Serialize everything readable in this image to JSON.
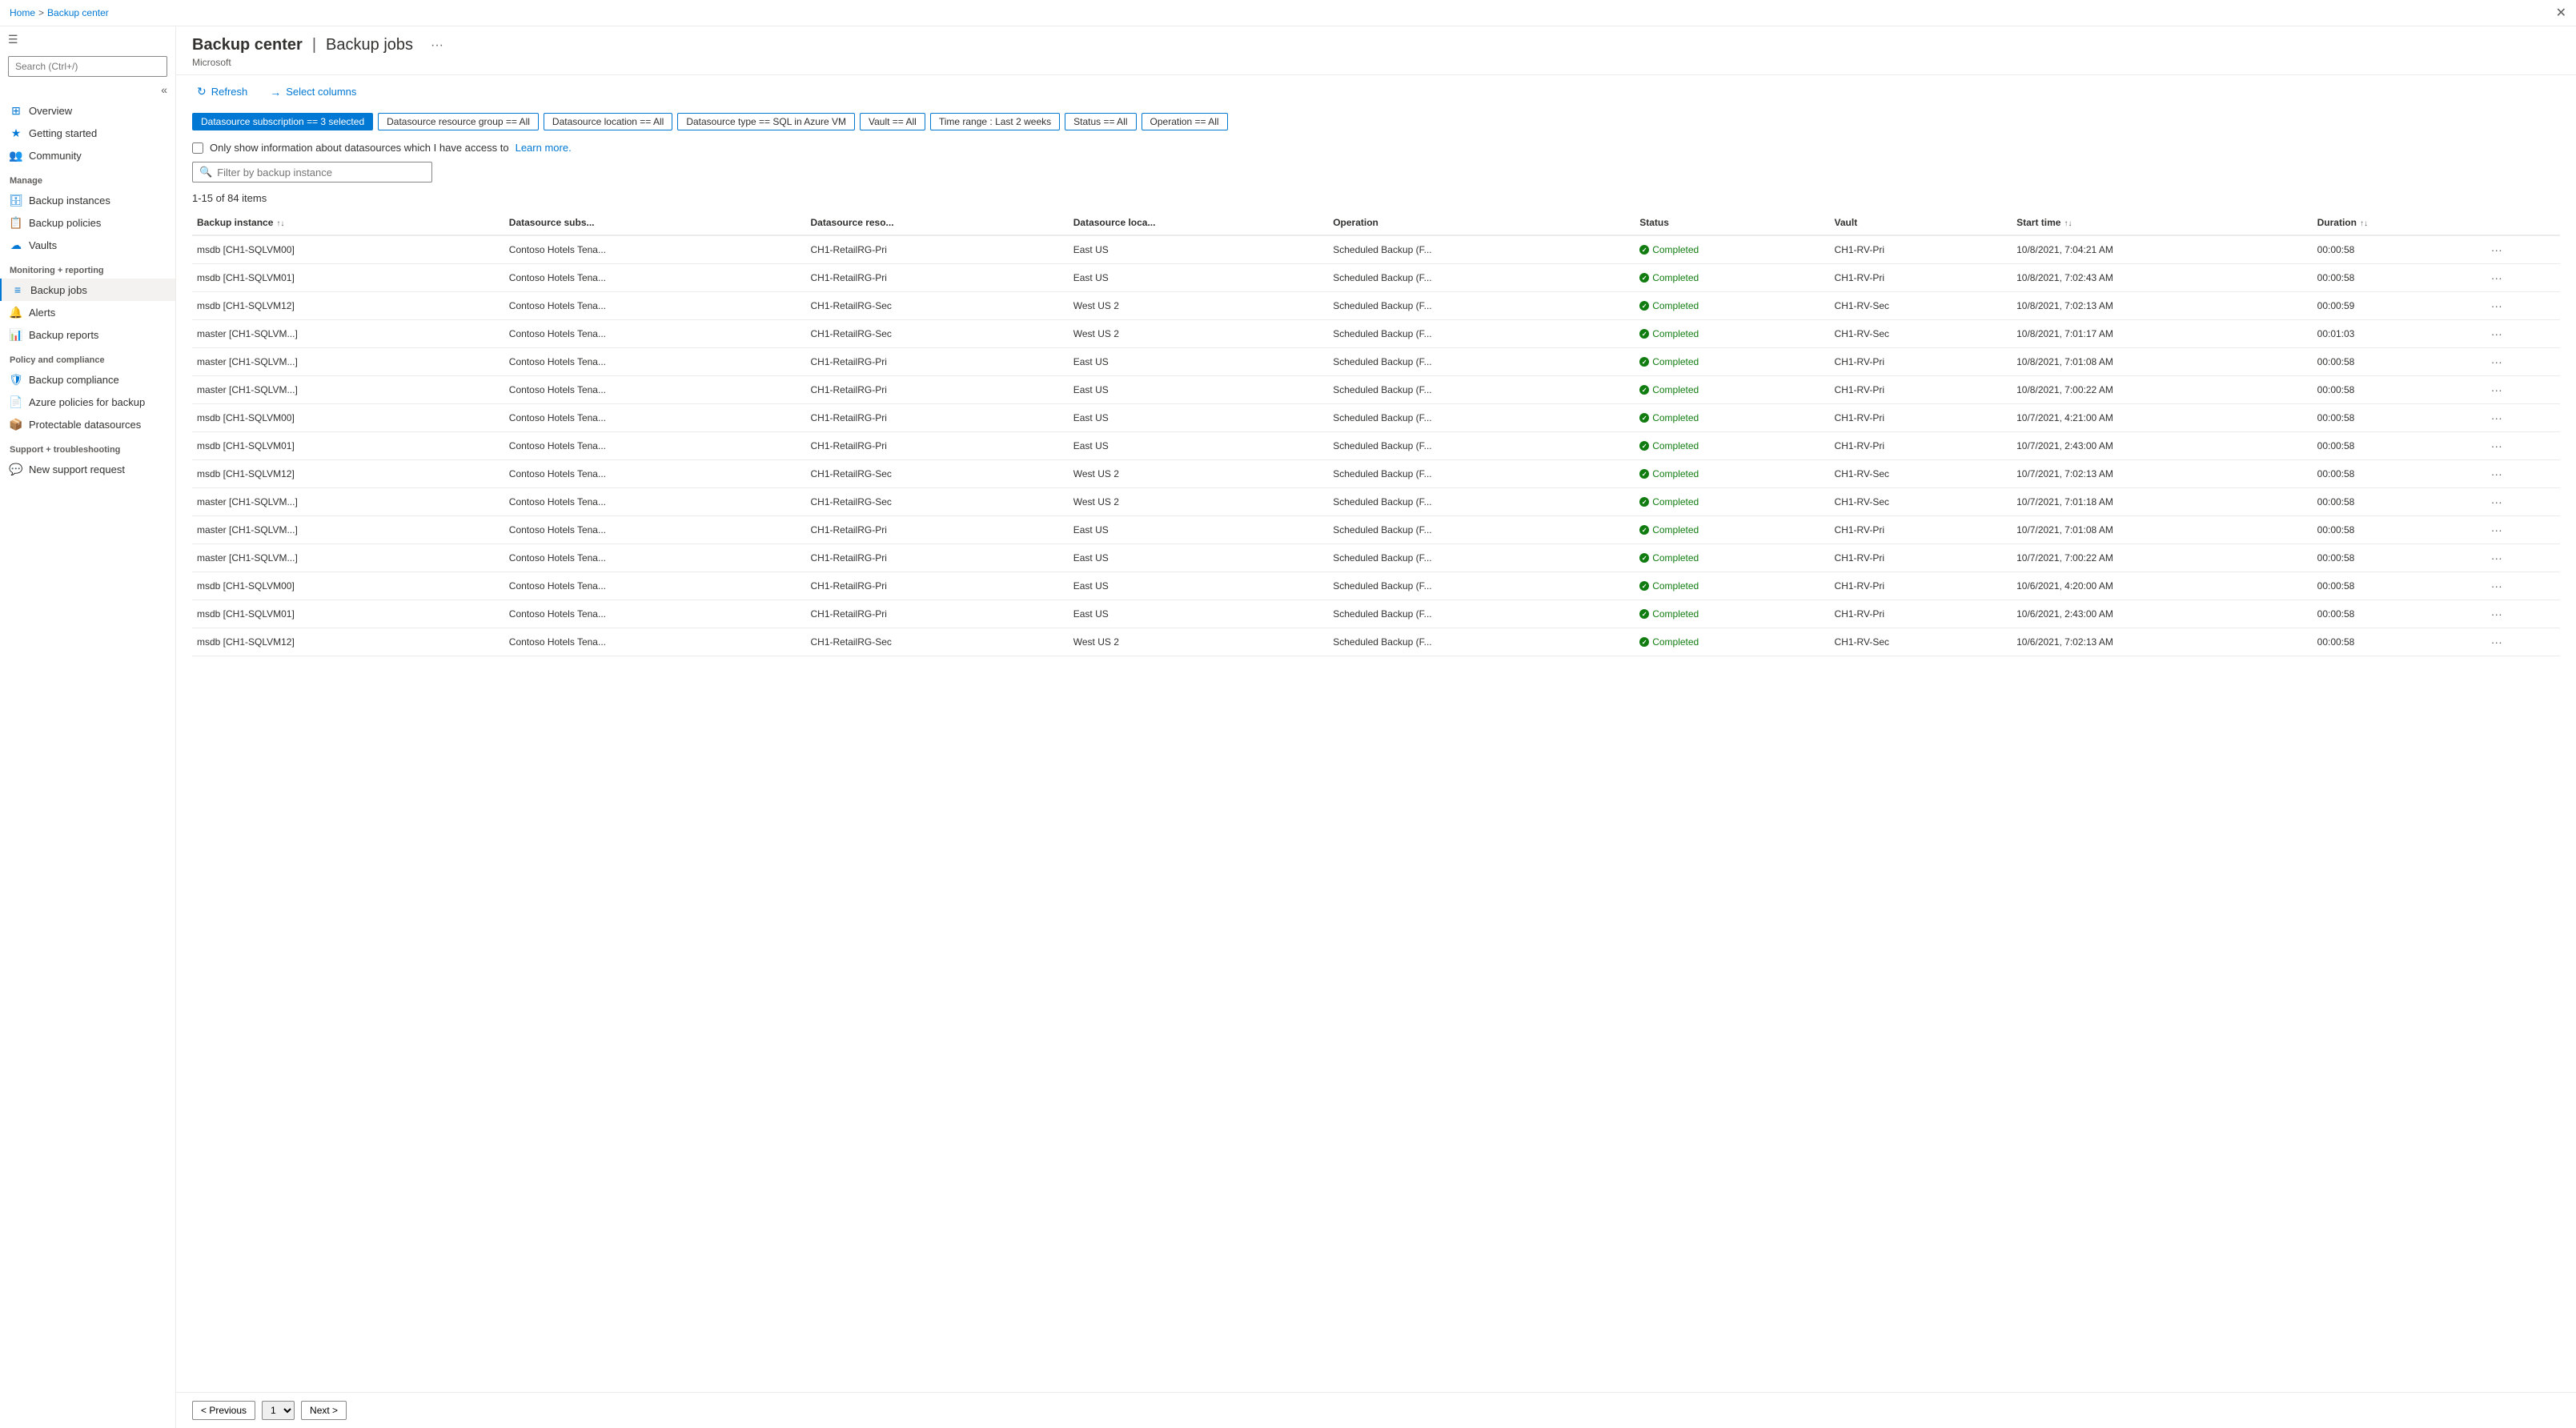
{
  "breadcrumb": {
    "home": "Home",
    "section": "Backup center"
  },
  "header": {
    "title": "Backup center",
    "subtitle": "Microsoft",
    "page": "Backup jobs",
    "more_label": "···"
  },
  "toolbar": {
    "refresh_label": "Refresh",
    "select_columns_label": "Select columns"
  },
  "filters": [
    {
      "id": "datasource_subscription",
      "label": "Datasource subscription == 3 selected",
      "active": true
    },
    {
      "id": "datasource_resource_group",
      "label": "Datasource resource group == All",
      "active": false
    },
    {
      "id": "datasource_location",
      "label": "Datasource location == All",
      "active": false
    },
    {
      "id": "datasource_type",
      "label": "Datasource type == SQL in Azure VM",
      "active": false
    },
    {
      "id": "vault",
      "label": "Vault == All",
      "active": false
    },
    {
      "id": "time_range",
      "label": "Time range : Last 2 weeks",
      "active": false
    },
    {
      "id": "status",
      "label": "Status == All",
      "active": false
    },
    {
      "id": "operation",
      "label": "Operation == All",
      "active": false
    }
  ],
  "checkbox_row": {
    "label": "Only show information about datasources which I have access to",
    "link_text": "Learn more."
  },
  "filter_input": {
    "placeholder": "Filter by backup instance"
  },
  "items_count": "1-15 of 84 items",
  "table": {
    "columns": [
      {
        "id": "backup_instance",
        "label": "Backup instance",
        "sortable": true
      },
      {
        "id": "datasource_subs",
        "label": "Datasource subs...",
        "sortable": false
      },
      {
        "id": "datasource_reso",
        "label": "Datasource reso...",
        "sortable": false
      },
      {
        "id": "datasource_loca",
        "label": "Datasource loca...",
        "sortable": false
      },
      {
        "id": "operation",
        "label": "Operation",
        "sortable": false
      },
      {
        "id": "status",
        "label": "Status",
        "sortable": false
      },
      {
        "id": "vault",
        "label": "Vault",
        "sortable": false
      },
      {
        "id": "start_time",
        "label": "Start time",
        "sortable": true
      },
      {
        "id": "duration",
        "label": "Duration",
        "sortable": true
      }
    ],
    "rows": [
      {
        "backup_instance": "msdb [CH1-SQLVM00]",
        "datasource_subs": "Contoso Hotels Tena...",
        "datasource_reso": "CH1-RetailRG-Pri",
        "datasource_loca": "East US",
        "operation": "Scheduled Backup (F...",
        "status": "Completed",
        "vault": "CH1-RV-Pri",
        "start_time": "10/8/2021, 7:04:21 AM",
        "duration": "00:00:58"
      },
      {
        "backup_instance": "msdb [CH1-SQLVM01]",
        "datasource_subs": "Contoso Hotels Tena...",
        "datasource_reso": "CH1-RetailRG-Pri",
        "datasource_loca": "East US",
        "operation": "Scheduled Backup (F...",
        "status": "Completed",
        "vault": "CH1-RV-Pri",
        "start_time": "10/8/2021, 7:02:43 AM",
        "duration": "00:00:58"
      },
      {
        "backup_instance": "msdb [CH1-SQLVM12]",
        "datasource_subs": "Contoso Hotels Tena...",
        "datasource_reso": "CH1-RetailRG-Sec",
        "datasource_loca": "West US 2",
        "operation": "Scheduled Backup (F...",
        "status": "Completed",
        "vault": "CH1-RV-Sec",
        "start_time": "10/8/2021, 7:02:13 AM",
        "duration": "00:00:59"
      },
      {
        "backup_instance": "master [CH1-SQLVM...]",
        "datasource_subs": "Contoso Hotels Tena...",
        "datasource_reso": "CH1-RetailRG-Sec",
        "datasource_loca": "West US 2",
        "operation": "Scheduled Backup (F...",
        "status": "Completed",
        "vault": "CH1-RV-Sec",
        "start_time": "10/8/2021, 7:01:17 AM",
        "duration": "00:01:03"
      },
      {
        "backup_instance": "master [CH1-SQLVM...]",
        "datasource_subs": "Contoso Hotels Tena...",
        "datasource_reso": "CH1-RetailRG-Pri",
        "datasource_loca": "East US",
        "operation": "Scheduled Backup (F...",
        "status": "Completed",
        "vault": "CH1-RV-Pri",
        "start_time": "10/8/2021, 7:01:08 AM",
        "duration": "00:00:58"
      },
      {
        "backup_instance": "master [CH1-SQLVM...]",
        "datasource_subs": "Contoso Hotels Tena...",
        "datasource_reso": "CH1-RetailRG-Pri",
        "datasource_loca": "East US",
        "operation": "Scheduled Backup (F...",
        "status": "Completed",
        "vault": "CH1-RV-Pri",
        "start_time": "10/8/2021, 7:00:22 AM",
        "duration": "00:00:58"
      },
      {
        "backup_instance": "msdb [CH1-SQLVM00]",
        "datasource_subs": "Contoso Hotels Tena...",
        "datasource_reso": "CH1-RetailRG-Pri",
        "datasource_loca": "East US",
        "operation": "Scheduled Backup (F...",
        "status": "Completed",
        "vault": "CH1-RV-Pri",
        "start_time": "10/7/2021, 4:21:00 AM",
        "duration": "00:00:58"
      },
      {
        "backup_instance": "msdb [CH1-SQLVM01]",
        "datasource_subs": "Contoso Hotels Tena...",
        "datasource_reso": "CH1-RetailRG-Pri",
        "datasource_loca": "East US",
        "operation": "Scheduled Backup (F...",
        "status": "Completed",
        "vault": "CH1-RV-Pri",
        "start_time": "10/7/2021, 2:43:00 AM",
        "duration": "00:00:58"
      },
      {
        "backup_instance": "msdb [CH1-SQLVM12]",
        "datasource_subs": "Contoso Hotels Tena...",
        "datasource_reso": "CH1-RetailRG-Sec",
        "datasource_loca": "West US 2",
        "operation": "Scheduled Backup (F...",
        "status": "Completed",
        "vault": "CH1-RV-Sec",
        "start_time": "10/7/2021, 7:02:13 AM",
        "duration": "00:00:58"
      },
      {
        "backup_instance": "master [CH1-SQLVM...]",
        "datasource_subs": "Contoso Hotels Tena...",
        "datasource_reso": "CH1-RetailRG-Sec",
        "datasource_loca": "West US 2",
        "operation": "Scheduled Backup (F...",
        "status": "Completed",
        "vault": "CH1-RV-Sec",
        "start_time": "10/7/2021, 7:01:18 AM",
        "duration": "00:00:58"
      },
      {
        "backup_instance": "master [CH1-SQLVM...]",
        "datasource_subs": "Contoso Hotels Tena...",
        "datasource_reso": "CH1-RetailRG-Pri",
        "datasource_loca": "East US",
        "operation": "Scheduled Backup (F...",
        "status": "Completed",
        "vault": "CH1-RV-Pri",
        "start_time": "10/7/2021, 7:01:08 AM",
        "duration": "00:00:58"
      },
      {
        "backup_instance": "master [CH1-SQLVM...]",
        "datasource_subs": "Contoso Hotels Tena...",
        "datasource_reso": "CH1-RetailRG-Pri",
        "datasource_loca": "East US",
        "operation": "Scheduled Backup (F...",
        "status": "Completed",
        "vault": "CH1-RV-Pri",
        "start_time": "10/7/2021, 7:00:22 AM",
        "duration": "00:00:58"
      },
      {
        "backup_instance": "msdb [CH1-SQLVM00]",
        "datasource_subs": "Contoso Hotels Tena...",
        "datasource_reso": "CH1-RetailRG-Pri",
        "datasource_loca": "East US",
        "operation": "Scheduled Backup (F...",
        "status": "Completed",
        "vault": "CH1-RV-Pri",
        "start_time": "10/6/2021, 4:20:00 AM",
        "duration": "00:00:58"
      },
      {
        "backup_instance": "msdb [CH1-SQLVM01]",
        "datasource_subs": "Contoso Hotels Tena...",
        "datasource_reso": "CH1-RetailRG-Pri",
        "datasource_loca": "East US",
        "operation": "Scheduled Backup (F...",
        "status": "Completed",
        "vault": "CH1-RV-Pri",
        "start_time": "10/6/2021, 2:43:00 AM",
        "duration": "00:00:58"
      },
      {
        "backup_instance": "msdb [CH1-SQLVM12]",
        "datasource_subs": "Contoso Hotels Tena...",
        "datasource_reso": "CH1-RetailRG-Sec",
        "datasource_loca": "West US 2",
        "operation": "Scheduled Backup (F...",
        "status": "Completed",
        "vault": "CH1-RV-Sec",
        "start_time": "10/6/2021, 7:02:13 AM",
        "duration": "00:00:58"
      }
    ]
  },
  "pagination": {
    "prev_label": "< Previous",
    "next_label": "Next >",
    "page_number": "1"
  },
  "sidebar": {
    "search_placeholder": "Search (Ctrl+/)",
    "nav_items": [
      {
        "id": "overview",
        "label": "Overview",
        "icon": "grid-icon",
        "section": null
      },
      {
        "id": "getting_started",
        "label": "Getting started",
        "icon": "star-icon",
        "section": null
      },
      {
        "id": "community",
        "label": "Community",
        "icon": "people-icon",
        "section": null
      },
      {
        "id": "backup_instances",
        "label": "Backup instances",
        "icon": "database-icon",
        "section": "Manage"
      },
      {
        "id": "backup_policies",
        "label": "Backup policies",
        "icon": "policy-icon",
        "section": null
      },
      {
        "id": "vaults",
        "label": "Vaults",
        "icon": "vault-icon",
        "section": null
      },
      {
        "id": "backup_jobs",
        "label": "Backup jobs",
        "icon": "jobs-icon",
        "section": "Monitoring + reporting",
        "active": true
      },
      {
        "id": "alerts",
        "label": "Alerts",
        "icon": "alert-icon",
        "section": null
      },
      {
        "id": "backup_reports",
        "label": "Backup reports",
        "icon": "reports-icon",
        "section": null
      },
      {
        "id": "backup_compliance",
        "label": "Backup compliance",
        "icon": "compliance-icon",
        "section": "Policy and compliance"
      },
      {
        "id": "azure_policies",
        "label": "Azure policies for backup",
        "icon": "azure-policy-icon",
        "section": null
      },
      {
        "id": "protectable_datasources",
        "label": "Protectable datasources",
        "icon": "datasource-icon",
        "section": null
      },
      {
        "id": "new_support_request",
        "label": "New support request",
        "icon": "support-icon",
        "section": "Support + troubleshooting"
      }
    ]
  }
}
